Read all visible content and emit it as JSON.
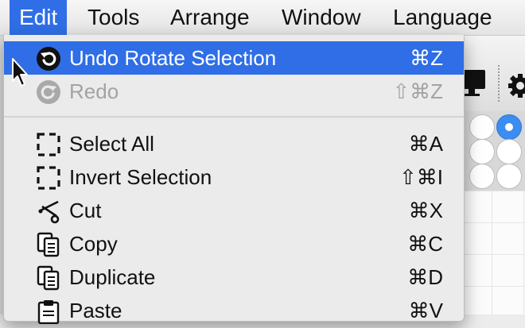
{
  "menubar": {
    "items": [
      {
        "label": "Edit",
        "active": true
      },
      {
        "label": "Tools"
      },
      {
        "label": "Arrange"
      },
      {
        "label": "Window"
      },
      {
        "label": "Language"
      }
    ]
  },
  "edit_menu": {
    "items": [
      {
        "label": "Undo Rotate Selection",
        "shortcut": "⌘Z",
        "icon": "undo-icon",
        "highlighted": true,
        "enabled": true
      },
      {
        "label": "Redo",
        "shortcut": "⇧⌘Z",
        "icon": "redo-icon",
        "enabled": false
      },
      {
        "label": "Select All",
        "shortcut": "⌘A",
        "icon": "select-all-icon",
        "enabled": true
      },
      {
        "label": "Invert Selection",
        "shortcut": "⇧⌘I",
        "icon": "invert-selection-icon",
        "enabled": true
      },
      {
        "label": "Cut",
        "shortcut": "⌘X",
        "icon": "scissors-icon",
        "enabled": true
      },
      {
        "label": "Copy",
        "shortcut": "⌘C",
        "icon": "copy-icon",
        "enabled": true
      },
      {
        "label": "Duplicate",
        "shortcut": "⌘D",
        "icon": "duplicate-icon",
        "enabled": true
      },
      {
        "label": "Paste",
        "shortcut": "⌘V",
        "icon": "paste-icon",
        "enabled": true
      }
    ]
  },
  "background": {
    "toolbar_icons": [
      "monitor-icon",
      "gear-icon"
    ],
    "selected_color": "#3b8df1"
  },
  "colors": {
    "highlight": "#2f6ee6",
    "menu_bg": "#ebebeb",
    "disabled_text": "#a3a3a3"
  }
}
